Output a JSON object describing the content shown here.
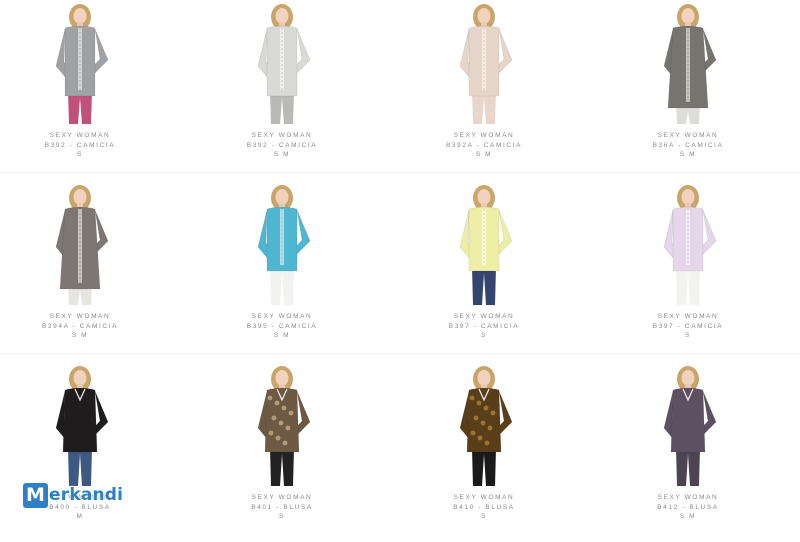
{
  "products": [
    {
      "brand": "SEXY WOMAN",
      "title": "B392 - CAMICIA",
      "sizes": "S",
      "color": "#9fa1a5",
      "legs": "#c0527a",
      "style": "shirt-long",
      "accent": "#5aa0c8"
    },
    {
      "brand": "SEXY WOMAN",
      "title": "B392 - CAMICIA",
      "sizes": "S M",
      "color": "#d9d9d6",
      "legs": "#b9b9b5",
      "style": "shirt-long",
      "accent": "#cfcfcc"
    },
    {
      "brand": "SEXY WOMAN",
      "title": "B392A - CAMICIA",
      "sizes": "S M",
      "color": "#e6d6ca",
      "legs": "#e8d6cc",
      "style": "shirt-long",
      "accent": "#e6d6ca"
    },
    {
      "brand": "SEXY WOMAN",
      "title": "B36A - CAMICIA",
      "sizes": "S M",
      "color": "#77736f",
      "legs": "#dcdcd8",
      "style": "tunic",
      "accent": "#77736f"
    },
    {
      "brand": "SEXY WOMAN",
      "title": "B394A - CAMICIA",
      "sizes": "S M",
      "color": "#7d7673",
      "legs": "#e5e5e1",
      "style": "tunic",
      "accent": "#7d7673"
    },
    {
      "brand": "SEXY WOMAN",
      "title": "B395 - CAMICIA",
      "sizes": "S M",
      "color": "#4fb6d1",
      "legs": "#f2f2f0",
      "style": "shirt",
      "accent": "#4fb6d1"
    },
    {
      "brand": "SEXY WOMAN",
      "title": "B397 - CAMICIA",
      "sizes": "S",
      "color": "#efeea6",
      "legs": "#35456f",
      "style": "shirt",
      "accent": "#efeea6"
    },
    {
      "brand": "SEXY WOMAN",
      "title": "B397 - CAMICIA",
      "sizes": "S",
      "color": "#e6d6ea",
      "legs": "#f2f2f0",
      "style": "shirt",
      "accent": "#e6d6ea"
    },
    {
      "brand": "SEXY WOMAN",
      "title": "B400 - BLUSA",
      "sizes": "M",
      "color": "#1e1c1c",
      "legs": "#3e5a82",
      "style": "blouse",
      "accent": "#1e1c1c"
    },
    {
      "brand": "SEXY WOMAN",
      "title": "B401 - BLUSA",
      "sizes": "S",
      "color": "#6e5a44",
      "legs": "#222222",
      "style": "blouse",
      "accent": "#c9b28a"
    },
    {
      "brand": "SEXY WOMAN",
      "title": "B410 - BLUSA",
      "sizes": "S",
      "color": "#5a3e1a",
      "legs": "#1a1a1a",
      "style": "blouse",
      "accent": "#b28a3a"
    },
    {
      "brand": "SEXY WOMAN",
      "title": "B412 - BLUSA",
      "sizes": "S M",
      "color": "#5e5063",
      "legs": "#4d4452",
      "style": "blouse",
      "accent": "#5e5063"
    }
  ],
  "logo": {
    "initial": "M",
    "rest": "erkandi",
    "color": "#2f7fc4"
  }
}
